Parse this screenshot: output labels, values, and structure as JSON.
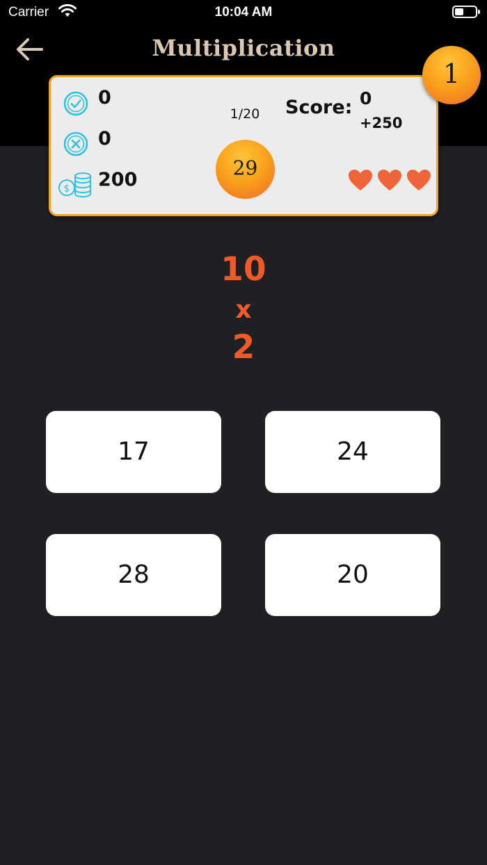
{
  "status_bar": {
    "carrier": "Carrier",
    "time": "10:04 AM"
  },
  "header": {
    "title": "Multiplication",
    "level": "1"
  },
  "stats": {
    "correct": "0",
    "wrong": "0",
    "coins": "200",
    "progress": "1/20",
    "timer": "29",
    "score_label": "Score:",
    "score": "0",
    "bonus": "+250",
    "lives": 3
  },
  "question": {
    "operand_a": "10",
    "operator": "x",
    "operand_b": "2"
  },
  "answers": [
    {
      "label": "17"
    },
    {
      "label": "24"
    },
    {
      "label": "28"
    },
    {
      "label": "20"
    }
  ],
  "colors": {
    "accent": "#f05a28",
    "badge_orange": "#f9a21c",
    "card_border": "#f2a21c",
    "icon_cyan": "#29c2e0",
    "heart": "#f0643a",
    "title": "#d8c8b4",
    "background": "#1f2023"
  },
  "icons": [
    "wifi-icon",
    "battery-icon",
    "back-arrow-icon",
    "check-circle-icon",
    "x-circle-icon",
    "coins-icon",
    "heart-icon"
  ]
}
